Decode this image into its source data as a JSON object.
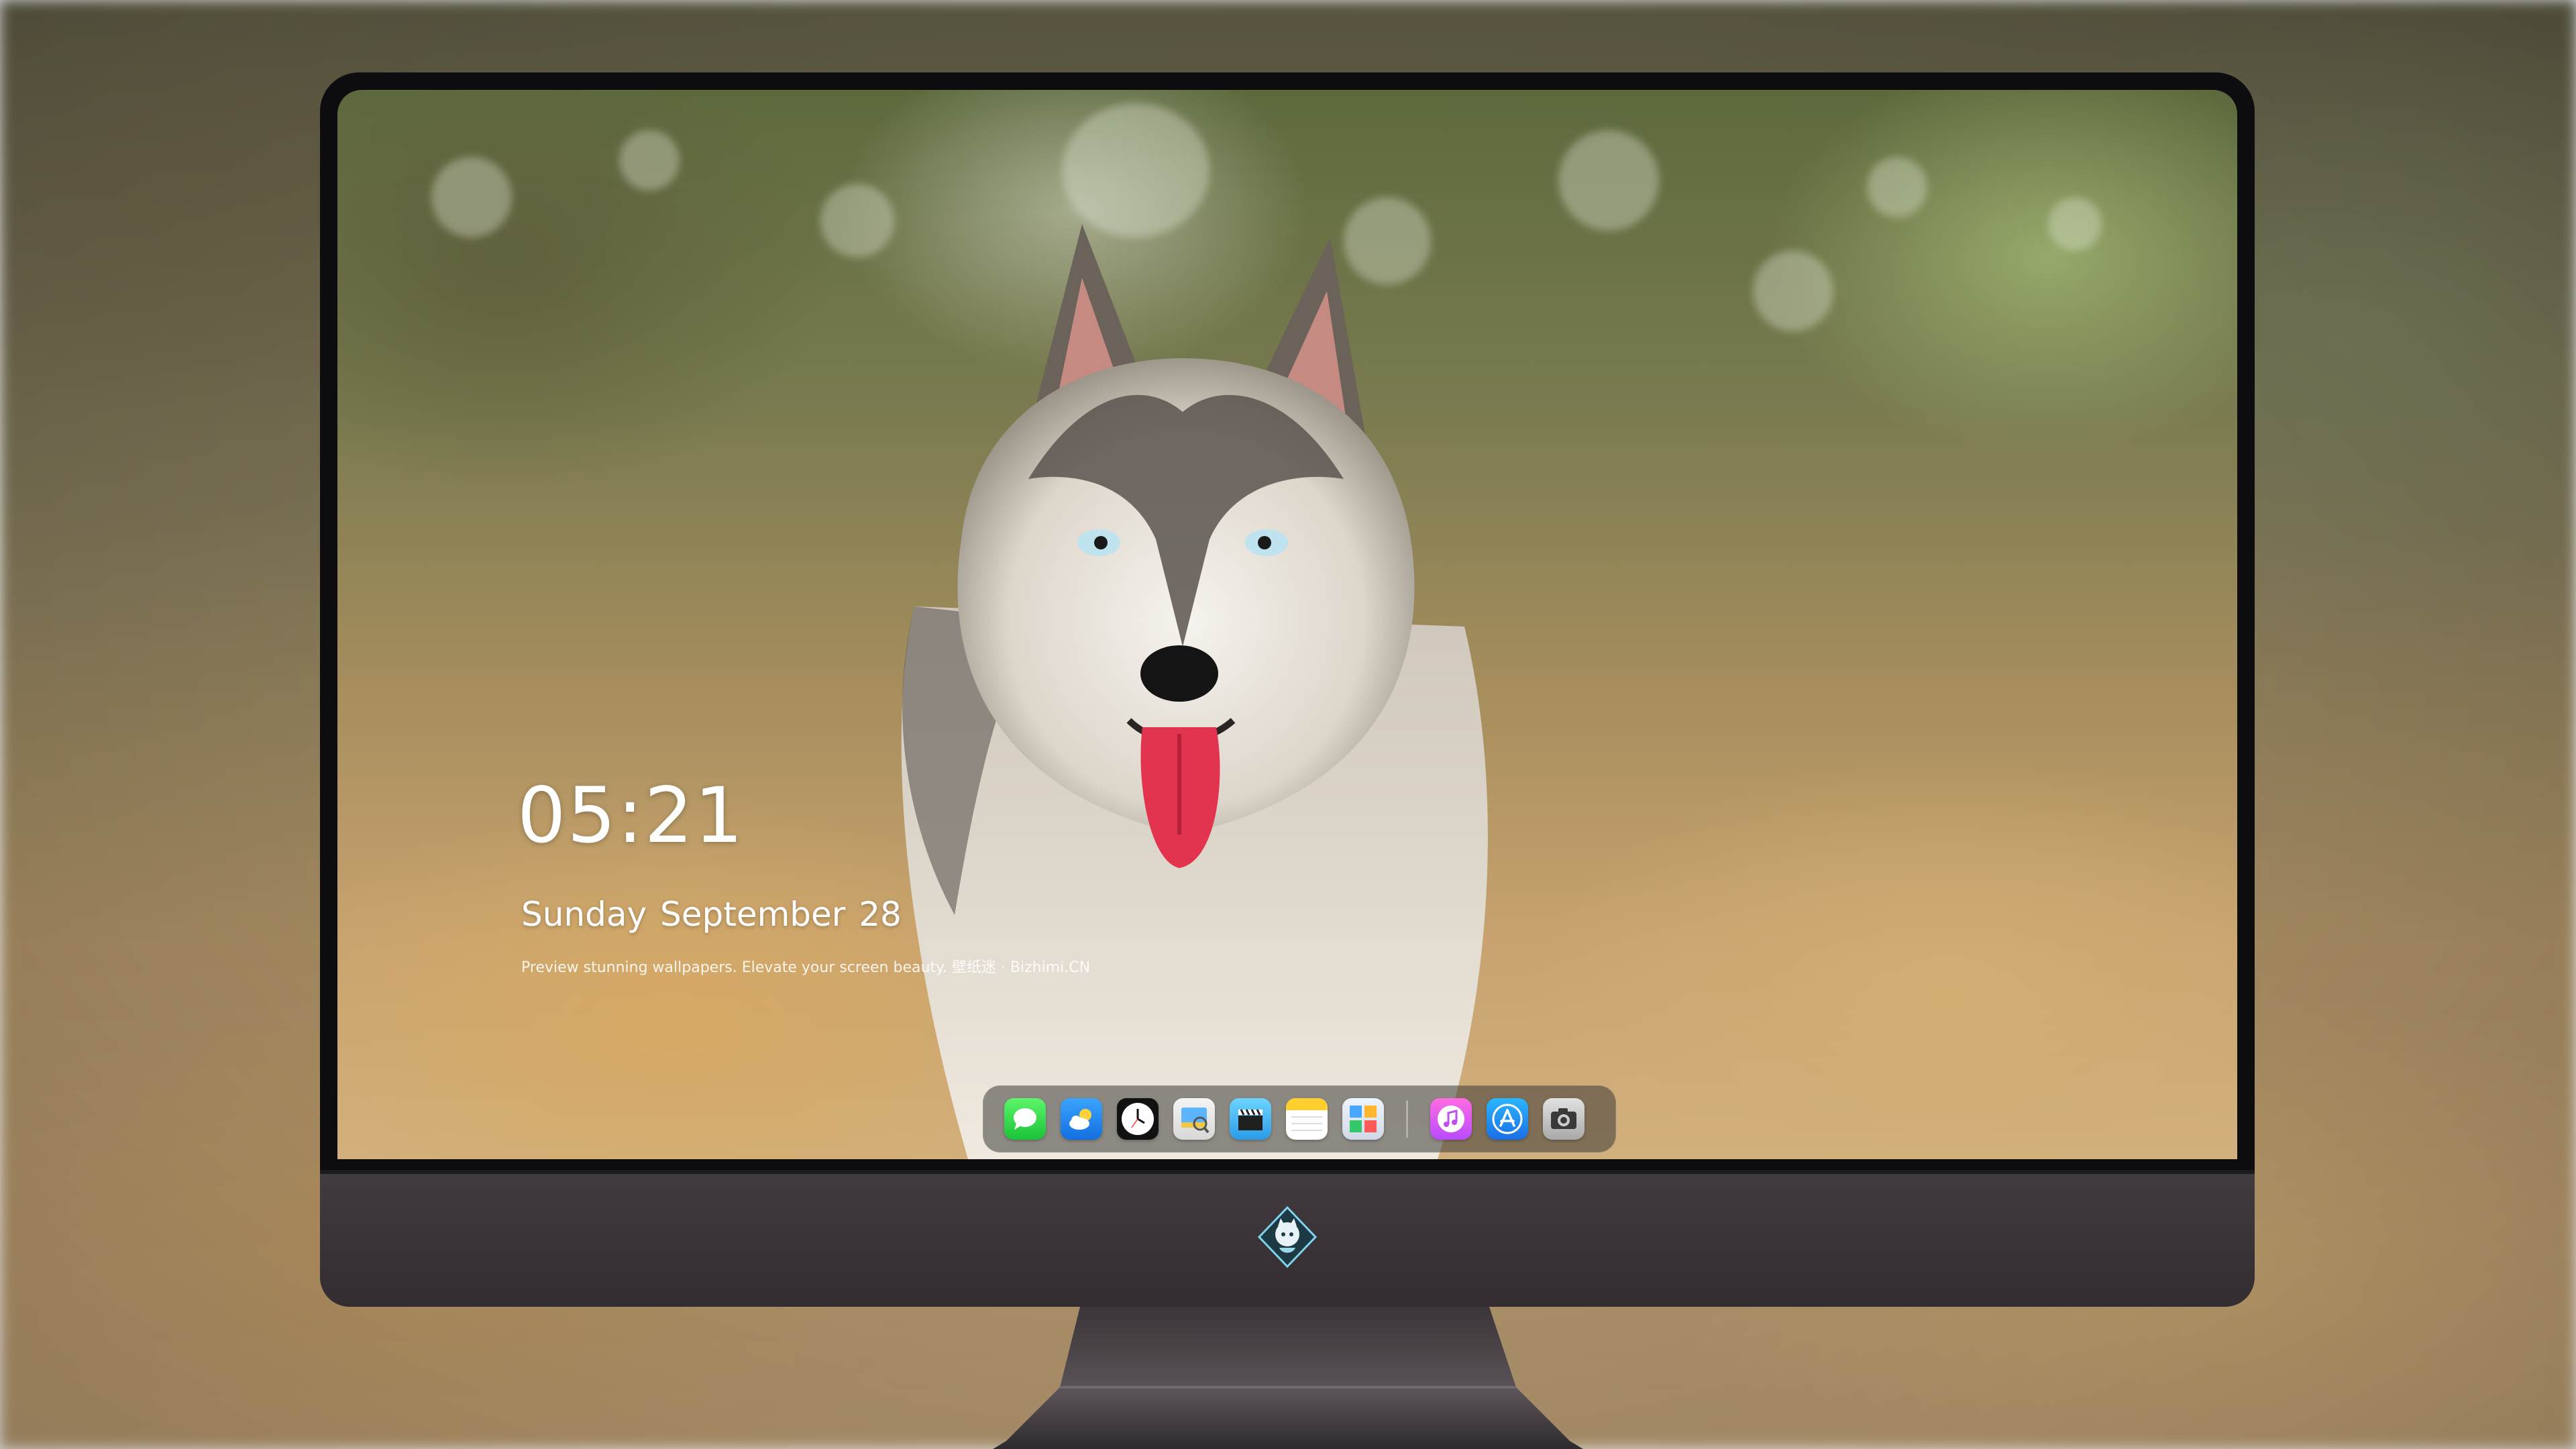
{
  "clock": {
    "time": "05:21",
    "date": "Sunday September  28",
    "tagline": "Preview stunning wallpapers. Elevate your screen beauty. 壁纸迷 · Bizhimi.CN"
  },
  "dock": {
    "apps": [
      {
        "name": "Messages",
        "icon": "messages-icon"
      },
      {
        "name": "Weather",
        "icon": "weather-icon"
      },
      {
        "name": "Clock",
        "icon": "clock-icon"
      },
      {
        "name": "Preview",
        "icon": "preview-icon"
      },
      {
        "name": "Clips",
        "icon": "clapperboard-icon"
      },
      {
        "name": "Notes",
        "icon": "notes-icon"
      },
      {
        "name": "Photo Booth",
        "icon": "gallery-icon"
      },
      {
        "name": "Music",
        "icon": "music-icon"
      },
      {
        "name": "App Store",
        "icon": "app-store-icon"
      },
      {
        "name": "Camera",
        "icon": "camera-icon"
      }
    ]
  },
  "colors": {
    "bezel": "#0d0d0f",
    "chin": "#3b353a",
    "dock_background": "rgba(60,58,55,0.55)",
    "clock_text": "#ffffff"
  }
}
